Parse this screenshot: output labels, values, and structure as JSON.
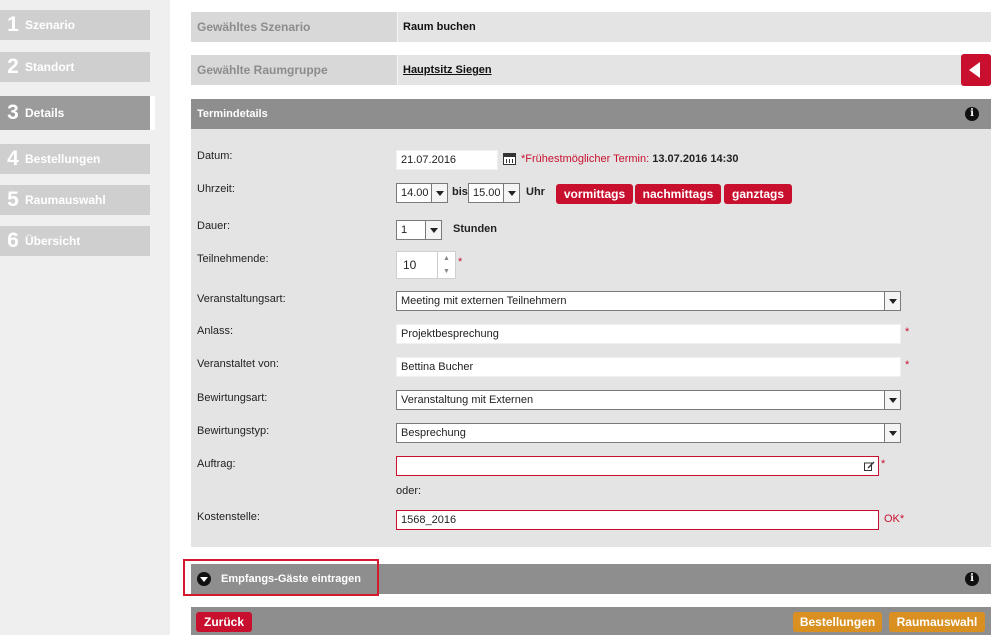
{
  "sidebar": {
    "steps": [
      {
        "num": "1",
        "label": "Szenario"
      },
      {
        "num": "2",
        "label": "Standort"
      },
      {
        "num": "3",
        "label": "Details"
      },
      {
        "num": "4",
        "label": "Bestellungen"
      },
      {
        "num": "5",
        "label": "Raumauswahl"
      },
      {
        "num": "6",
        "label": "Übersicht"
      }
    ]
  },
  "summary": {
    "scenario_label": "Gewähltes Szenario",
    "scenario_value": "Raum buchen",
    "roomgroup_label": "Gewählte Raumgruppe",
    "roomgroup_value": "Hauptsitz Siegen"
  },
  "termin": {
    "title": "Termindetails",
    "info_icon": "i",
    "datum_label": "Datum:",
    "datum_value": "21.07.2016",
    "earliest_prefix": "*Frühestmöglicher Termin:",
    "earliest_value": "13.07.2016 14:30",
    "uhrzeit_label": "Uhrzeit:",
    "time_from": "14.00",
    "bis": "bis",
    "time_to": "15.00",
    "uhr": "Uhr",
    "btn_vormittags": "vormittags",
    "btn_nachmittags": "nachmittags",
    "btn_ganztags": "ganztags",
    "dauer_label": "Dauer:",
    "dauer_value": "1",
    "stunden": "Stunden",
    "teilnehmende_label": "Teilnehmende:",
    "teilnehmende_value": "10",
    "veranstaltungsart_label": "Veranstaltungsart:",
    "veranstaltungsart_value": "Meeting mit externen Teilnehmern",
    "anlass_label": "Anlass:",
    "anlass_value": "Projektbesprechung",
    "veranstaltet_label": "Veranstaltet von:",
    "veranstaltet_value": "Bettina Bucher",
    "bewirtungsart_label": "Bewirtungsart:",
    "bewirtungsart_value": "Veranstaltung mit Externen",
    "bewirtungstyp_label": "Bewirtungstyp:",
    "bewirtungstyp_value": "Besprechung",
    "auftrag_label": "Auftrag:",
    "auftrag_value": "",
    "oder": "oder:",
    "kostenstelle_label": "Kostenstelle:",
    "kostenstelle_value": "1568_2016",
    "ok_marker": "OK*",
    "required_marker": "*"
  },
  "guests": {
    "title": "Empfangs-Gäste eintragen",
    "info_icon": "i"
  },
  "footer": {
    "zurueck": "Zurück",
    "bestellungen": "Bestellungen",
    "raumauswahl": "Raumauswahl"
  },
  "colors": {
    "accent_red": "#c8102e",
    "accent_orange": "#d99020",
    "panel_gray": "#8e8e8e"
  }
}
